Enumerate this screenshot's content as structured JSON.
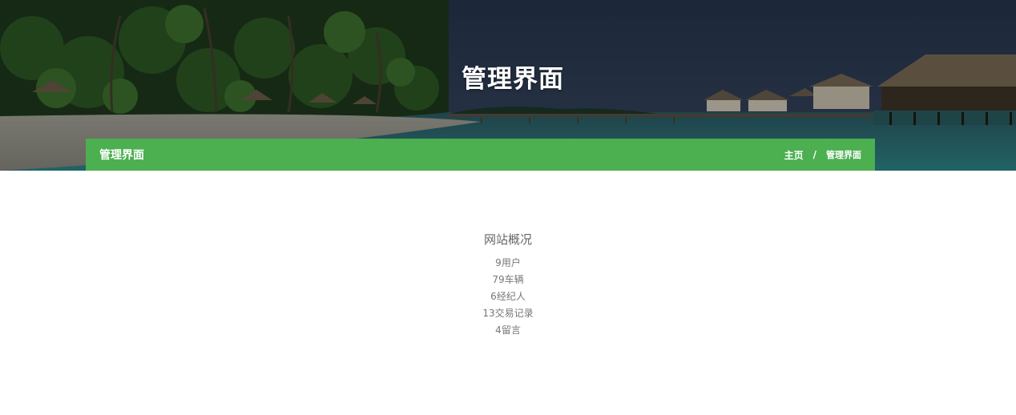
{
  "hero": {
    "title": "管理界面"
  },
  "breadcrumb_bar": {
    "title": "管理界面",
    "home": "主页",
    "separator": "/",
    "current": "管理界面",
    "color": "#4caf50"
  },
  "overview": {
    "title": "网站概况",
    "stats": [
      {
        "count": "9",
        "label": "用户"
      },
      {
        "count": "79",
        "label": "车辆"
      },
      {
        "count": "6",
        "label": "经纪人"
      },
      {
        "count": "13",
        "label": "交易记录"
      },
      {
        "count": "4",
        "label": "留言"
      }
    ]
  }
}
